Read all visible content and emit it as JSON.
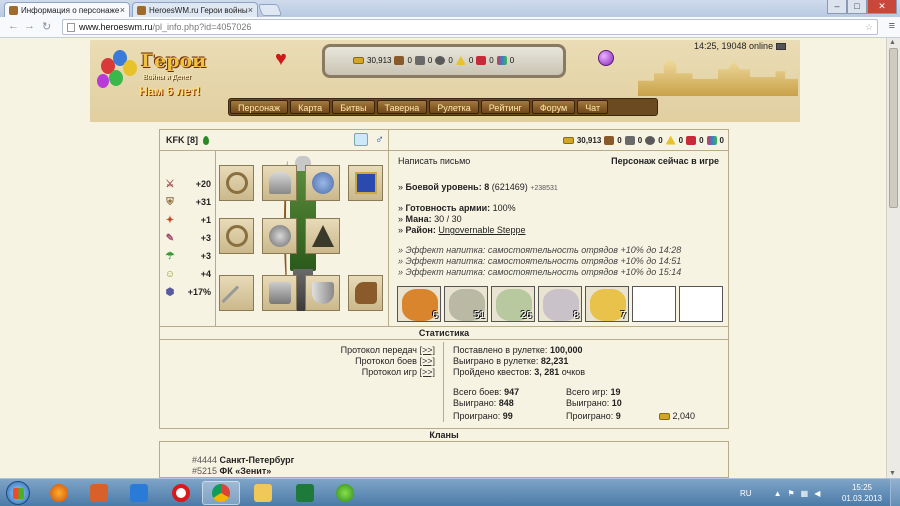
{
  "browser": {
    "tabs": [
      {
        "title": "Информация о персонаже",
        "close": "×",
        "active": true
      },
      {
        "title": "HeroesWM.ru Герои войны",
        "close": "×",
        "active": false
      }
    ],
    "url_host": "www.heroeswm.ru",
    "url_path": "/pl_info.php?id=4057026",
    "window_buttons": {
      "minimize": "–",
      "maximize": "□",
      "close": "✕"
    }
  },
  "header": {
    "logo_title": "Герои",
    "logo_subtitle": "Войны и Денег",
    "logo_age": "Нам 6 лет!",
    "resources": {
      "gold": "30,913",
      "wood": "0",
      "ore": "0",
      "mercury": "0",
      "sulfur": "0",
      "crystals": "0",
      "gems": "0"
    },
    "time_online": "14:25, 19048 online",
    "menu": [
      "Персонаж",
      "Карта",
      "Битвы",
      "Таверна",
      "Рулетка",
      "Рейтинг",
      "Форум",
      "Чат"
    ]
  },
  "character": {
    "name": "KFK",
    "level_bracket": "[8]",
    "stats": [
      {
        "icon": "attack-icon",
        "glyph": "⚔",
        "value": "+20"
      },
      {
        "icon": "defense-icon",
        "glyph": "⛨",
        "value": "+31"
      },
      {
        "icon": "spellpower-icon",
        "glyph": "✦",
        "value": "+1"
      },
      {
        "icon": "knowledge-icon",
        "glyph": "✎",
        "value": "+3"
      },
      {
        "icon": "luck-icon",
        "glyph": "☂",
        "value": "+3"
      },
      {
        "icon": "morale-icon",
        "glyph": "☺",
        "value": "+4"
      },
      {
        "icon": "initiative-icon",
        "glyph": "⬢",
        "value": "+17%"
      }
    ],
    "write_letter": "Написать письмо",
    "status": "Персонаж сейчас в игре",
    "combat_level_label": "Боевой уровень:",
    "combat_level": "8",
    "combat_exp": "(621469)",
    "combat_exp_delta": "+238531",
    "army_ready_label": "Готовность армии:",
    "army_ready": "100%",
    "mana_label": "Мана:",
    "mana": "30 / 30",
    "district_label": "Район:",
    "district": "Ungovernable Steppe",
    "effects": [
      "Эффект напитка: самостоятельность отрядов +10% до 14:28",
      "Эффект напитка: самостоятельность отрядов +10% до 14:51",
      "Эффект напитка: самостоятельность отрядов +10% до 15:14"
    ],
    "army": [
      {
        "count": "6",
        "color": "#d9852e"
      },
      {
        "count": "51",
        "color": "#b9b9a4"
      },
      {
        "count": "26",
        "color": "#b8c9a0"
      },
      {
        "count": "8",
        "color": "#c9c2c9"
      },
      {
        "count": "7",
        "color": "#e8c24a"
      },
      {
        "count": "",
        "color": ""
      },
      {
        "count": "",
        "color": ""
      }
    ]
  },
  "statistics": {
    "title": "Статистика",
    "protocols": [
      {
        "label": "Протокол передач",
        "link": "[>>]"
      },
      {
        "label": "Протокол боев",
        "link": "[>>]"
      },
      {
        "label": "Протокол игр",
        "link": "[>>]"
      }
    ],
    "roulette_bet_label": "Поставлено в рулетке:",
    "roulette_bet": "100,000",
    "roulette_won_label": "Выиграно в рулетке:",
    "roulette_won": "82,231",
    "quests_label": "Пройдено квестов:",
    "quests": "3, 281",
    "quests_suffix": "очков",
    "battles_total_label": "Всего боев:",
    "battles_total": "947",
    "battles_won_label": "Выиграно:",
    "battles_won": "848",
    "battles_lost_label": "Проиграно:",
    "battles_lost": "99",
    "games_total_label": "Всего игр:",
    "games_total": "19",
    "games_won_label": "Выиграно:",
    "games_won": "10",
    "games_lost_label": "Проиграно:",
    "games_lost": "9",
    "games_gold": "2,040"
  },
  "clans": {
    "title": "Кланы",
    "items": [
      {
        "num": "#4444",
        "name": "Санкт-Петербург"
      },
      {
        "num": "#5215",
        "name": "ФК «Зенит»"
      }
    ]
  },
  "taskbar": {
    "lang": "RU",
    "time": "15:25",
    "date": "01.03.2013"
  }
}
